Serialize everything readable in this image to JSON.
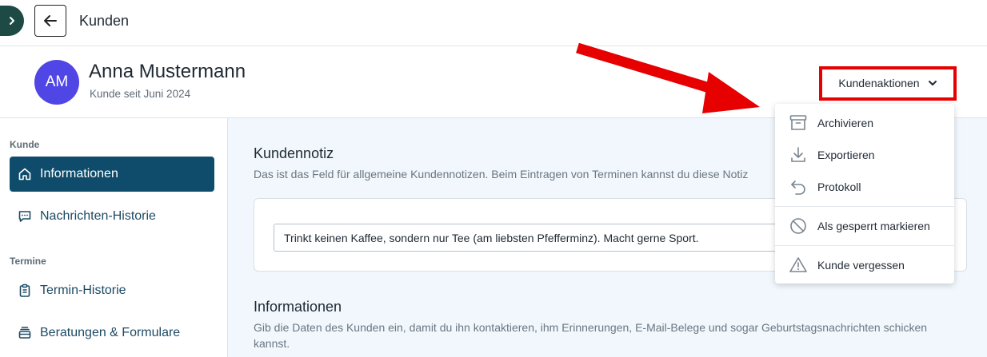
{
  "header": {
    "title": "Kunden"
  },
  "customer": {
    "initials": "AM",
    "name": "Anna Mustermann",
    "since": "Kunde seit Juni 2024"
  },
  "actions": {
    "label": "Kundenaktionen"
  },
  "sidebar": {
    "sections": [
      {
        "label": "Kunde"
      },
      {
        "label": "Termine"
      }
    ],
    "items": [
      {
        "label": "Informationen",
        "active": true
      },
      {
        "label": "Nachrichten-Historie",
        "active": false
      },
      {
        "label": "Termin-Historie",
        "active": false
      },
      {
        "label": "Beratungen & Formulare",
        "active": false
      }
    ]
  },
  "main": {
    "note_title": "Kundennotiz",
    "note_desc": "Das ist das Feld für allgemeine Kundennotizen. Beim Eintragen von Terminen kannst du diese Notiz",
    "note_value": "Trinkt keinen Kaffee, sondern nur Tee (am liebsten Pfefferminz). Macht gerne Sport.",
    "info_title": "Informationen",
    "info_desc": "Gib die Daten des Kunden ein, damit du ihn kontaktieren, ihm Erinnerungen, E-Mail-Belege und sogar Geburtstagsnachrichten schicken kannst."
  },
  "dropdown": {
    "items": [
      {
        "label": "Archivieren",
        "icon": "archive-icon"
      },
      {
        "label": "Exportieren",
        "icon": "download-icon"
      },
      {
        "label": "Protokoll",
        "icon": "undo-arrow-icon"
      },
      {
        "label": "Als gesperrt markieren",
        "icon": "block-icon"
      },
      {
        "label": "Kunde vergessen",
        "icon": "warning-icon"
      }
    ]
  },
  "colors": {
    "accent": "#0f4c6b",
    "avatar": "#4f46e5",
    "highlight": "#e60000",
    "main_bg": "#f1f7fd"
  }
}
